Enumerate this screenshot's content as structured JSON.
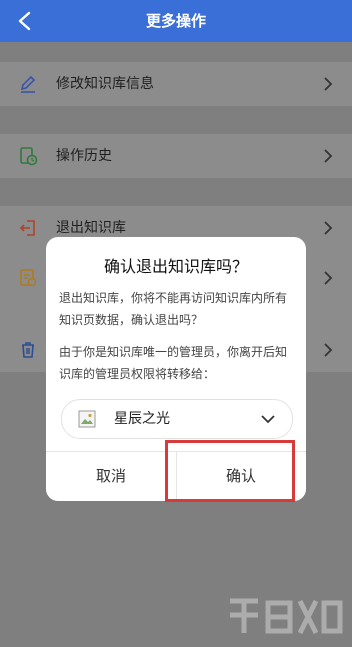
{
  "header": {
    "title": "更多操作",
    "back_icon": "chevron-left-icon"
  },
  "menu": {
    "items": [
      {
        "label": "修改知识库信息",
        "icon": "pencil-icon"
      },
      {
        "label": "操作历史",
        "icon": "history-icon"
      },
      {
        "label": "退出知识库",
        "icon": "exit-icon"
      },
      {
        "label": "",
        "icon": "document-icon"
      },
      {
        "label": "",
        "icon": "trash-icon"
      }
    ]
  },
  "dialog": {
    "title": "确认退出知识库吗？",
    "message_1": "退出知识库，你将不能再访问知识库内所有知识页数据，确认退出吗？",
    "message_2": "由于你是知识库唯一的管理员，你离开后知识库的管理员权限将转移给：",
    "selected_user": "星辰之光",
    "cancel_label": "取消",
    "confirm_label": "确认"
  },
  "colors": {
    "header_bg": "#3a6fd8",
    "highlight_border": "#d63b3b"
  }
}
